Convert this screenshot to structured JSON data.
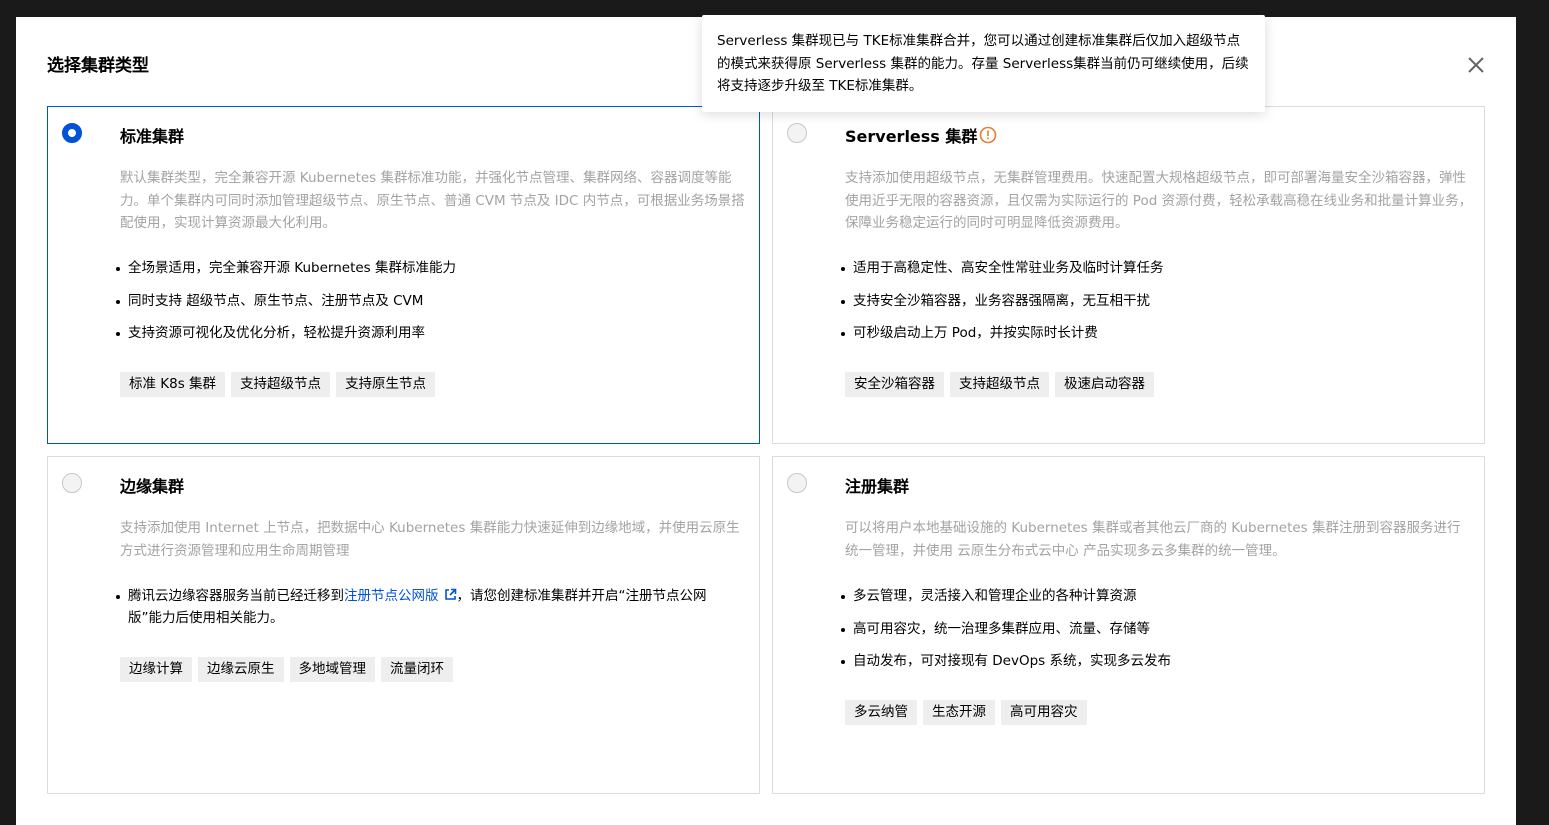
{
  "dialog": {
    "title": "选择集群类型"
  },
  "tooltip": {
    "text": "Serverless 集群现已与 TKE标准集群合并，您可以通过创建标准集群后仅加入超级节点的模式来获得原 Serverless 集群的能力。存量 Serverless集群当前仍可继续使用，后续将支持逐步升级至 TKE标准集群。"
  },
  "cards": {
    "standard": {
      "title": "标准集群",
      "selected": true,
      "description": "默认集群类型，完全兼容开源 Kubernetes 集群标准功能，并强化节点管理、集群网络、容器调度等能力。单个集群内可同时添加管理超级节点、原生节点、普通 CVM 节点及 IDC 内节点，可根据业务场景搭配使用，实现计算资源最大化利用。",
      "features": [
        "全场景适用，完全兼容开源 Kubernetes 集群标准能力",
        "同时支持 超级节点、原生节点、注册节点及 CVM",
        "支持资源可视化及优化分析，轻松提升资源利用率"
      ],
      "tags": [
        "标准 K8s 集群",
        "支持超级节点",
        "支持原生节点"
      ]
    },
    "serverless": {
      "title": "Serverless 集群",
      "selected": false,
      "icon": "warning-circle-icon",
      "description": "支持添加使用超级节点，无集群管理费用。快速配置大规格超级节点，即可部署海量安全沙箱容器，弹性使用近乎无限的容器资源，且仅需为实际运行的 Pod 资源付费，轻松承载高稳在线业务和批量计算业务，保障业务稳定运行的同时可明显降低资源费用。",
      "features": [
        "适用于高稳定性、高安全性常驻业务及临时计算任务",
        "支持安全沙箱容器，业务容器强隔离，无互相干扰",
        "可秒级启动上万 Pod，并按实际时长计费"
      ],
      "tags": [
        "安全沙箱容器",
        "支持超级节点",
        "极速启动容器"
      ]
    },
    "edge": {
      "title": "边缘集群",
      "selected": false,
      "description": "支持添加使用 Internet 上节点，把数据中心 Kubernetes 集群能力快速延伸到边缘地域，并使用云原生方式进行资源管理和应用生命周期管理",
      "feature_prefix": "腾讯云边缘容器服务当前已经迁移到",
      "feature_link": "注册节点公网版",
      "feature_suffix": "，请您创建标准集群并开启“注册节点公网版”能力后使用相关能力。",
      "tags": [
        "边缘计算",
        "边缘云原生",
        "多地域管理",
        "流量闭环"
      ]
    },
    "registered": {
      "title": "注册集群",
      "selected": false,
      "description": "可以将用户本地基础设施的 Kubernetes 集群或者其他云厂商的 Kubernetes 集群注册到容器服务进行统一管理，并使用 云原生分布式云中心 产品实现多云多集群的统一管理。",
      "features": [
        "多云管理，灵活接入和管理企业的各种计算资源",
        "高可用容灾，统一治理多集群应用、流量、存储等",
        "自动发布，可对接现有 DevOps 系统，实现多云发布"
      ],
      "tags": [
        "多云纳管",
        "生态开源",
        "高可用容灾"
      ]
    }
  },
  "colors": {
    "accent": "#0052d9",
    "warning": "#ed7b2f",
    "muted_text": "#a3a3a3",
    "tag_bg": "#eeeeee"
  }
}
